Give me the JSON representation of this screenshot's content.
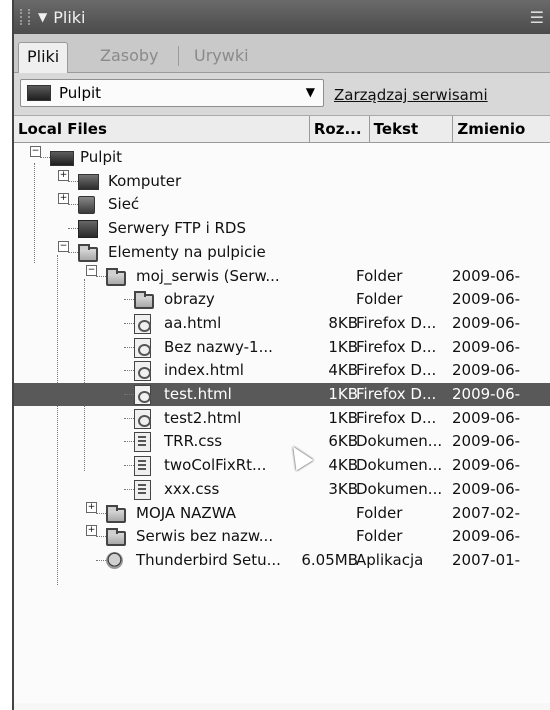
{
  "panel": {
    "title": "Pliki"
  },
  "tabs": [
    {
      "label": "Pliki",
      "active": true
    },
    {
      "label": "Zasoby",
      "active": false
    },
    {
      "label": "Urywki",
      "active": false
    }
  ],
  "site_select": {
    "value": "Pulpit",
    "manage_link": "Zarządzaj serwisami"
  },
  "columns": [
    {
      "label": "Local Files"
    },
    {
      "label": "Roz..."
    },
    {
      "label": "Tekst"
    },
    {
      "label": "Zmienio"
    }
  ],
  "rows": [
    {
      "name": "Pulpit",
      "size": "",
      "type": "",
      "modified": "",
      "indent": 0,
      "icon": "monitor-icon",
      "expander": "-"
    },
    {
      "name": "Komputer",
      "size": "",
      "type": "",
      "modified": "",
      "indent": 1,
      "icon": "computer-icon",
      "expander": "+"
    },
    {
      "name": "Sieć",
      "size": "",
      "type": "",
      "modified": "",
      "indent": 1,
      "icon": "network-icon",
      "expander": "+"
    },
    {
      "name": "Serwery FTP i RDS",
      "size": "",
      "type": "",
      "modified": "",
      "indent": 1,
      "icon": "server-icon",
      "expander": ""
    },
    {
      "name": "Elementy na pulpicie",
      "size": "",
      "type": "",
      "modified": "",
      "indent": 1,
      "icon": "folder-icon",
      "expander": "-"
    },
    {
      "name": "moj_serwis (Serw...",
      "size": "",
      "type": "Folder",
      "modified": "2009-06-",
      "indent": 2,
      "icon": "folder-icon",
      "expander": "-"
    },
    {
      "name": "obrazy",
      "size": "",
      "type": "Folder",
      "modified": "2009-06-",
      "indent": 3,
      "icon": "folder-icon",
      "expander": ""
    },
    {
      "name": "aa.html",
      "size": "8KB",
      "type": "Firefox D...",
      "modified": "2009-06-",
      "indent": 3,
      "icon": "html-file-icon",
      "expander": ""
    },
    {
      "name": "Bez nazwy-1...",
      "size": "1KB",
      "type": "Firefox D...",
      "modified": "2009-06-",
      "indent": 3,
      "icon": "html-file-icon",
      "expander": ""
    },
    {
      "name": "index.html",
      "size": "4KB",
      "type": "Firefox D...",
      "modified": "2009-06-",
      "indent": 3,
      "icon": "html-file-icon",
      "expander": ""
    },
    {
      "name": "test.html",
      "size": "1KB",
      "type": "Firefox D...",
      "modified": "2009-06-",
      "indent": 3,
      "icon": "html-file-icon",
      "expander": "",
      "selected": true
    },
    {
      "name": "test2.html",
      "size": "1KB",
      "type": "Firefox D...",
      "modified": "2009-06-",
      "indent": 3,
      "icon": "html-file-icon",
      "expander": ""
    },
    {
      "name": "TRR.css",
      "size": "6KB",
      "type": "Dokumen...",
      "modified": "2009-06-",
      "indent": 3,
      "icon": "css-file-icon",
      "expander": ""
    },
    {
      "name": "twoColFixRt...",
      "size": "4KB",
      "type": "Dokumen...",
      "modified": "2009-06-",
      "indent": 3,
      "icon": "css-file-icon",
      "expander": ""
    },
    {
      "name": "xxx.css",
      "size": "3KB",
      "type": "Dokumen...",
      "modified": "2009-06-",
      "indent": 3,
      "icon": "css-file-icon",
      "expander": ""
    },
    {
      "name": "MOJA NAZWA",
      "size": "",
      "type": "Folder",
      "modified": "2007-02-",
      "indent": 2,
      "icon": "folder-icon",
      "expander": "+"
    },
    {
      "name": "Serwis bez nazw...",
      "size": "",
      "type": "Folder",
      "modified": "2009-06-",
      "indent": 2,
      "icon": "folder-icon",
      "expander": "+"
    },
    {
      "name": "Thunderbird Setu...",
      "size": "6.05MB",
      "type": "Aplikacja",
      "modified": "2007-01-",
      "indent": 2,
      "icon": "app-icon",
      "expander": ""
    }
  ]
}
